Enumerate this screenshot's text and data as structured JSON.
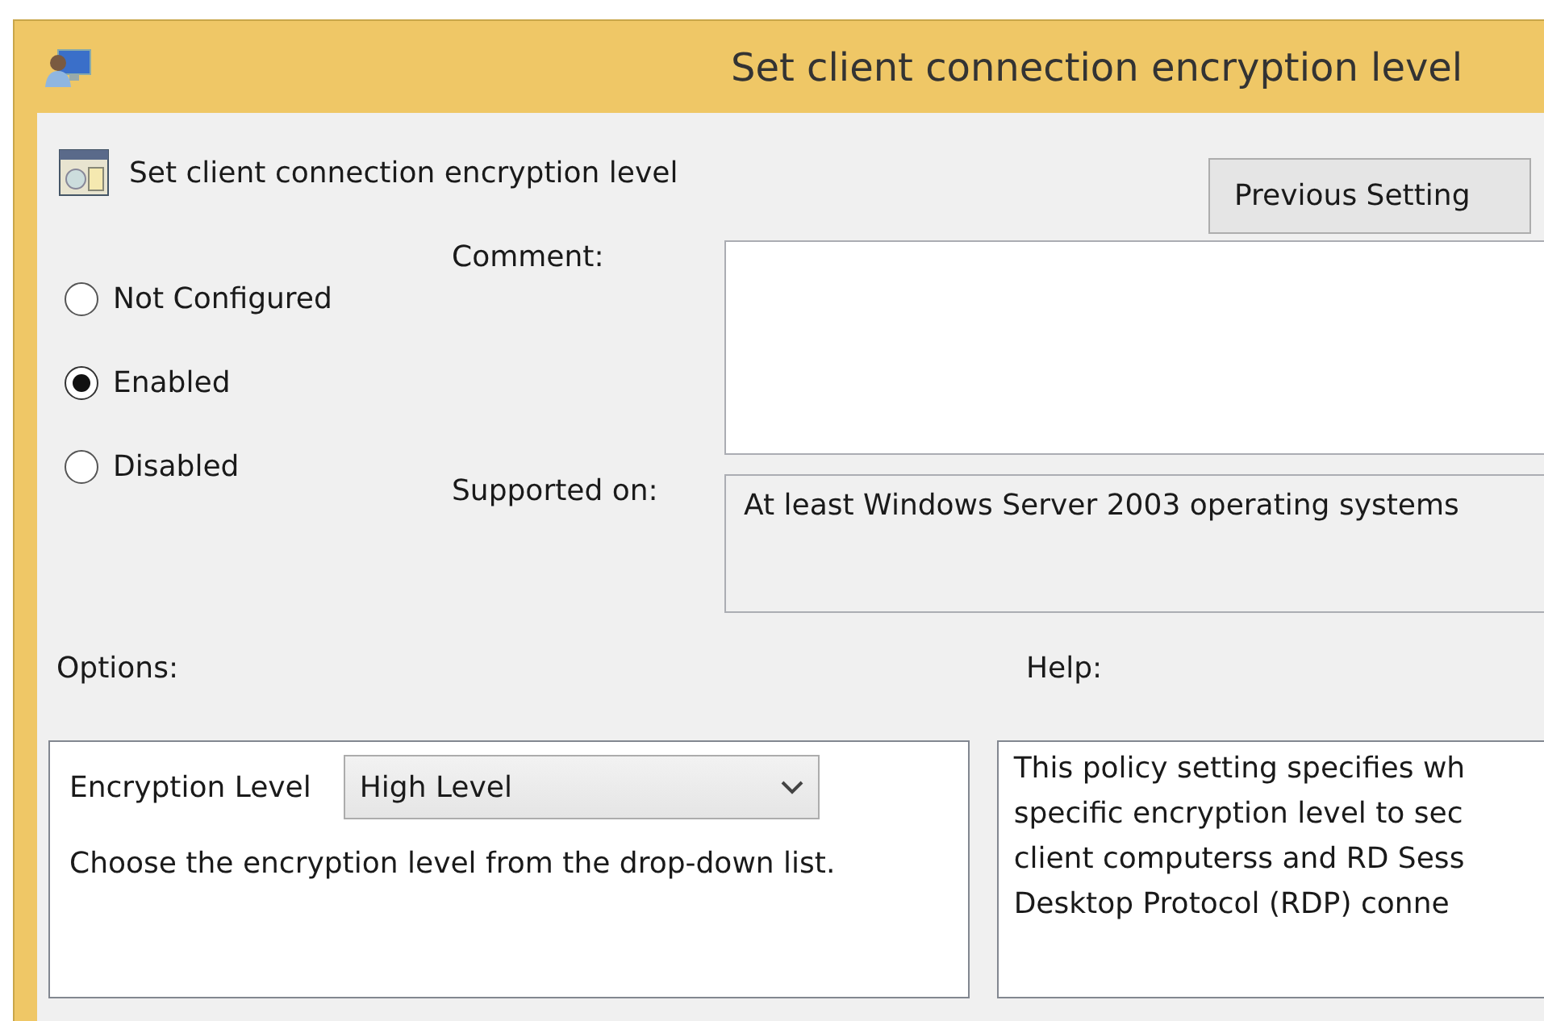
{
  "window": {
    "title": "Set client connection encryption level"
  },
  "heading": "Set client connection encryption level",
  "buttons": [
    {
      "label": "Previous Setting"
    }
  ],
  "state_options": [
    {
      "label": "Not Configured",
      "selected": false
    },
    {
      "label": "Enabled",
      "selected": true
    },
    {
      "label": "Disabled",
      "selected": false
    }
  ],
  "comment": {
    "label": "Comment:"
  },
  "supported_on": {
    "label": "Supported on:",
    "value": "At least Windows Server 2003 operating systems"
  },
  "options": {
    "label": "Options:",
    "setting_label": "Encryption Level",
    "dropdown_value": "High Level",
    "description": "Choose the encryption level from the drop-down list."
  },
  "help": {
    "label": "Help:",
    "lines": [
      "This policy setting specifies wh",
      "specific encryption level to sec",
      "client computerss and RD Sess",
      "Desktop Protocol (RDP) conne"
    ]
  }
}
